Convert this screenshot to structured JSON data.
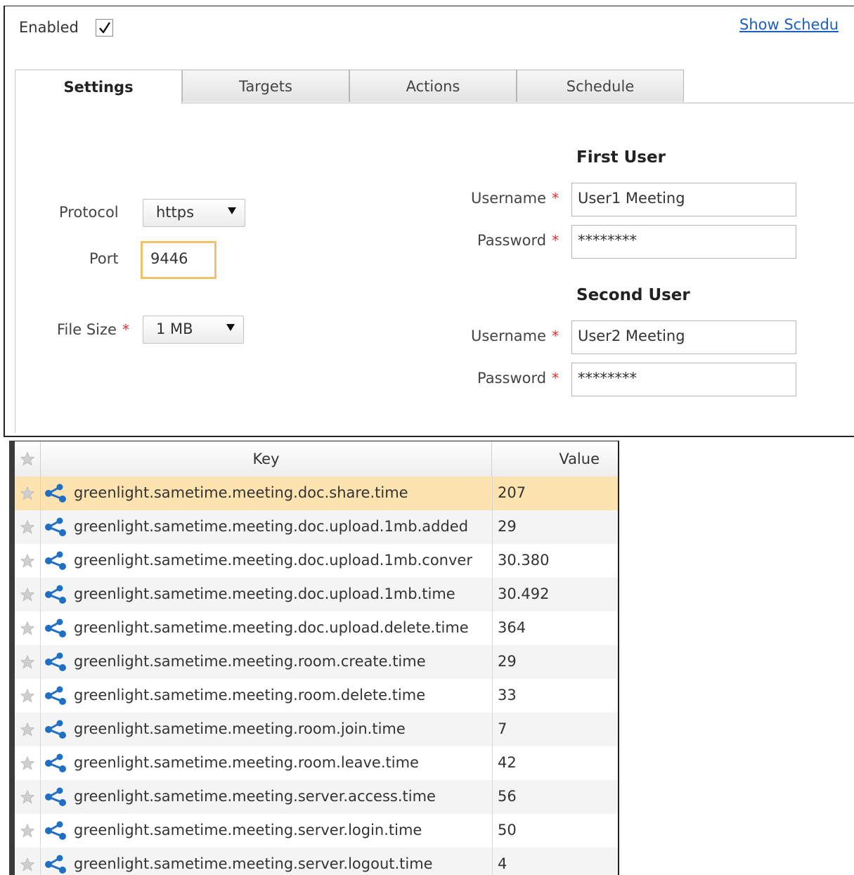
{
  "header": {
    "enabled_label": "Enabled",
    "enabled_checked": true,
    "show_link": "Show Schedu"
  },
  "tabs": [
    {
      "label": "Settings",
      "active": true
    },
    {
      "label": "Targets",
      "active": false
    },
    {
      "label": "Actions",
      "active": false
    },
    {
      "label": "Schedule",
      "active": false
    }
  ],
  "settings": {
    "protocol_label": "Protocol",
    "protocol_value": "https",
    "port_label": "Port",
    "port_value": "9446",
    "file_size_label": "File Size",
    "file_size_value": "1 MB",
    "required_marker": "*",
    "first_user": {
      "heading": "First User",
      "username_label": "Username",
      "username_value": "User1 Meeting",
      "password_label": "Password",
      "password_value": "********"
    },
    "second_user": {
      "heading": "Second User",
      "username_label": "Username",
      "username_value": "User2 Meeting",
      "password_label": "Password",
      "password_value": "********"
    }
  },
  "table": {
    "columns": {
      "key": "Key",
      "value": "Value"
    },
    "rows": [
      {
        "key": "greenlight.sametime.meeting.doc.share.time",
        "value": "207",
        "selected": true
      },
      {
        "key": "greenlight.sametime.meeting.doc.upload.1mb.added",
        "value": "29"
      },
      {
        "key": "greenlight.sametime.meeting.doc.upload.1mb.conver",
        "value": "30.380"
      },
      {
        "key": "greenlight.sametime.meeting.doc.upload.1mb.time",
        "value": "30.492"
      },
      {
        "key": "greenlight.sametime.meeting.doc.upload.delete.time",
        "value": "364"
      },
      {
        "key": "greenlight.sametime.meeting.room.create.time",
        "value": "29"
      },
      {
        "key": "greenlight.sametime.meeting.room.delete.time",
        "value": "33"
      },
      {
        "key": "greenlight.sametime.meeting.room.join.time",
        "value": "7"
      },
      {
        "key": "greenlight.sametime.meeting.room.leave.time",
        "value": "42"
      },
      {
        "key": "greenlight.sametime.meeting.server.access.time",
        "value": "56"
      },
      {
        "key": "greenlight.sametime.meeting.server.login.time",
        "value": "50"
      },
      {
        "key": "greenlight.sametime.meeting.server.logout.time",
        "value": "4"
      }
    ]
  },
  "colors": {
    "link": "#1a5fc8",
    "required": "#e03030",
    "selected_row": "#fde3b0",
    "focus_border": "#f5c06a",
    "share_icon": "#1f6fc4"
  },
  "icons": {
    "row_star": "star-icon",
    "row_type": "share-icon",
    "dropdown": "chevron-down-icon",
    "checkbox": "check-icon"
  }
}
